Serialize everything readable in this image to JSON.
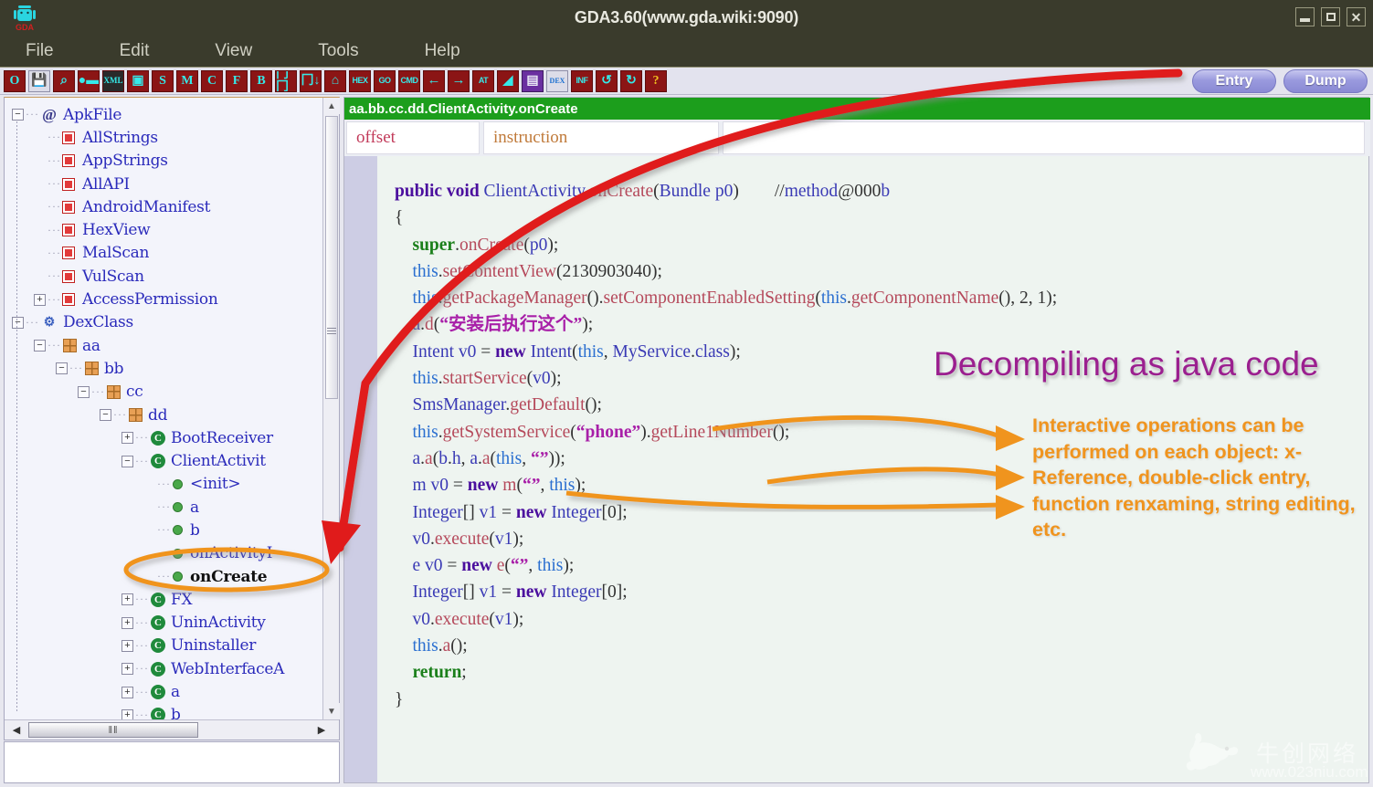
{
  "window": {
    "title": "GDA3.60(www.gda.wiki:9090)",
    "app_icon": "android-robot-icon",
    "minimize_label": "–",
    "maximize_label": "□",
    "close_label": "✕"
  },
  "menubar": {
    "items": [
      {
        "label": "File"
      },
      {
        "label": "Edit"
      },
      {
        "label": "View"
      },
      {
        "label": "Tools"
      },
      {
        "label": "Help"
      }
    ]
  },
  "toolbar": {
    "buttons": [
      {
        "name": "open-apk-button",
        "glyph": "O",
        "style": "red"
      },
      {
        "name": "save-button",
        "glyph": "💾",
        "style": "save"
      },
      {
        "name": "search-button",
        "glyph": "⌕",
        "style": "red"
      },
      {
        "name": "compare-button",
        "glyph": "●▬",
        "style": "red"
      },
      {
        "name": "xml-button",
        "glyph": "XML",
        "style": "xml"
      },
      {
        "name": "android-button",
        "glyph": "▣",
        "style": "red"
      },
      {
        "name": "strings-button",
        "glyph": "S",
        "style": "red"
      },
      {
        "name": "manifest-button",
        "glyph": "M",
        "style": "red"
      },
      {
        "name": "class-button",
        "glyph": "C",
        "style": "red"
      },
      {
        "name": "field-button",
        "glyph": "F",
        "style": "red"
      },
      {
        "name": "bytecode-button",
        "glyph": "B",
        "style": "red"
      },
      {
        "name": "expand-all-button",
        "glyph": "冂冂",
        "style": "red"
      },
      {
        "name": "collapse-all-button",
        "glyph": "冂↓",
        "style": "red"
      },
      {
        "name": "tree-button",
        "glyph": "⌂",
        "style": "red"
      },
      {
        "name": "hex-button",
        "glyph": "HEX",
        "style": "tiny"
      },
      {
        "name": "goto-button",
        "glyph": "GO",
        "style": "tiny"
      },
      {
        "name": "cmd-button",
        "glyph": "CMD",
        "style": "tiny"
      },
      {
        "name": "back-button",
        "glyph": "←",
        "style": "arrow"
      },
      {
        "name": "forward-button",
        "glyph": "→",
        "style": "arrow"
      },
      {
        "name": "at-button",
        "glyph": "AT",
        "style": "tiny"
      },
      {
        "name": "map-button",
        "glyph": "◢",
        "style": "red"
      },
      {
        "name": "note-button",
        "glyph": "▤",
        "style": "purple"
      },
      {
        "name": "dex-button",
        "glyph": "DEX",
        "style": "dex"
      },
      {
        "name": "inf-button",
        "glyph": "INF",
        "style": "tiny"
      },
      {
        "name": "refresh-button",
        "glyph": "↺",
        "style": "red"
      },
      {
        "name": "undo-button",
        "glyph": "↻",
        "style": "red"
      },
      {
        "name": "help-button",
        "glyph": "?",
        "style": "q"
      }
    ],
    "entry_label": "Entry",
    "dump_label": "Dump"
  },
  "tree": {
    "nodes": [
      {
        "indent": 0,
        "expander": "−",
        "icon": "at-icon",
        "label": "ApkFile"
      },
      {
        "indent": 1,
        "expander": "",
        "icon": "red-box-icon",
        "label": "AllStrings"
      },
      {
        "indent": 1,
        "expander": "",
        "icon": "red-box-icon",
        "label": "AppStrings"
      },
      {
        "indent": 1,
        "expander": "",
        "icon": "red-box-icon",
        "label": "AllAPI"
      },
      {
        "indent": 1,
        "expander": "",
        "icon": "red-box-icon",
        "label": "AndroidManifest"
      },
      {
        "indent": 1,
        "expander": "",
        "icon": "red-box-icon",
        "label": "HexView"
      },
      {
        "indent": 1,
        "expander": "",
        "icon": "red-box-icon",
        "label": "MalScan"
      },
      {
        "indent": 1,
        "expander": "",
        "icon": "red-box-icon",
        "label": "VulScan"
      },
      {
        "indent": 1,
        "expander": "+",
        "icon": "red-box-icon",
        "label": "AccessPermission"
      },
      {
        "indent": 0,
        "expander": "−",
        "icon": "dexclass-icon",
        "label": "DexClass"
      },
      {
        "indent": 1,
        "expander": "−",
        "icon": "package-icon",
        "label": "aa"
      },
      {
        "indent": 2,
        "expander": "−",
        "icon": "package-icon",
        "label": "bb"
      },
      {
        "indent": 3,
        "expander": "−",
        "icon": "package-icon",
        "label": "cc"
      },
      {
        "indent": 4,
        "expander": "−",
        "icon": "package-icon",
        "label": "dd"
      },
      {
        "indent": 5,
        "expander": "+",
        "icon": "class-icon",
        "label": "BootReceiver"
      },
      {
        "indent": 5,
        "expander": "−",
        "icon": "class-icon",
        "label": "ClientActivit"
      },
      {
        "indent": 6,
        "expander": "",
        "icon": "method-icon",
        "label": "<init>"
      },
      {
        "indent": 6,
        "expander": "",
        "icon": "method-icon",
        "label": "a"
      },
      {
        "indent": 6,
        "expander": "",
        "icon": "method-icon",
        "label": "b"
      },
      {
        "indent": 6,
        "expander": "",
        "icon": "method-icon",
        "label": "onActivityI"
      },
      {
        "indent": 6,
        "expander": "",
        "icon": "method-icon",
        "label": "onCreate",
        "selected": true
      },
      {
        "indent": 5,
        "expander": "+",
        "icon": "class-icon",
        "label": "FX"
      },
      {
        "indent": 5,
        "expander": "+",
        "icon": "class-icon",
        "label": "UninActivity"
      },
      {
        "indent": 5,
        "expander": "+",
        "icon": "class-icon",
        "label": "Uninstaller"
      },
      {
        "indent": 5,
        "expander": "+",
        "icon": "class-icon",
        "label": "WebInterfaceA"
      },
      {
        "indent": 5,
        "expander": "+",
        "icon": "class-icon",
        "label": "a"
      },
      {
        "indent": 5,
        "expander": "+",
        "icon": "class-icon",
        "label": "b"
      }
    ],
    "hscroll_grip": "‖‖",
    "up_arrow": "▲",
    "down_arrow": "▼",
    "left_arrow": "◀",
    "right_arrow": "▶"
  },
  "code": {
    "header": "aa.bb.cc.dd.ClientActivity.onCreate",
    "columns": [
      {
        "label": "offset"
      },
      {
        "label": "instruction"
      },
      {
        "label": ""
      }
    ],
    "lines": [
      "public void ClientActivity.onCreate(Bundle p0)        //method@000b",
      "{",
      "    super.onCreate(p0);",
      "    this.setContentView(2130903040);",
      "    this.getPackageManager().setComponentEnabledSetting(this.getComponentName(), 2, 1);",
      "    a.d(“安装后执行这个”);",
      "    Intent v0 = new Intent(this, MyService.class);",
      "    this.startService(v0);",
      "    SmsManager.getDefault();",
      "    this.getSystemService(“phone”).getLine1Number();",
      "    a.a(b.h, a.a(this, “”));",
      "    m v0 = new m(“”, this);",
      "    Integer[] v1 = new Integer[0];",
      "    v0.execute(v1);",
      "    e v0 = new e(“”, this);",
      "    Integer[] v1 = new Integer[0];",
      "    v0.execute(v1);",
      "    this.a();",
      "    return;",
      "}"
    ]
  },
  "annotations": {
    "watermark_java": "Decompiling as java code",
    "callout": "Interactive operations can be performed on each object: x-Reference, double-click entry, function renxaming, string editing, etc.",
    "accent_orange": "#f0941e",
    "accent_red": "#e02020",
    "accent_purple": "#9b1f8f"
  },
  "footer_watermark": {
    "company_cn": "牛创网络",
    "url": "www.023niu.com",
    "logo": "bull-logo-icon"
  }
}
